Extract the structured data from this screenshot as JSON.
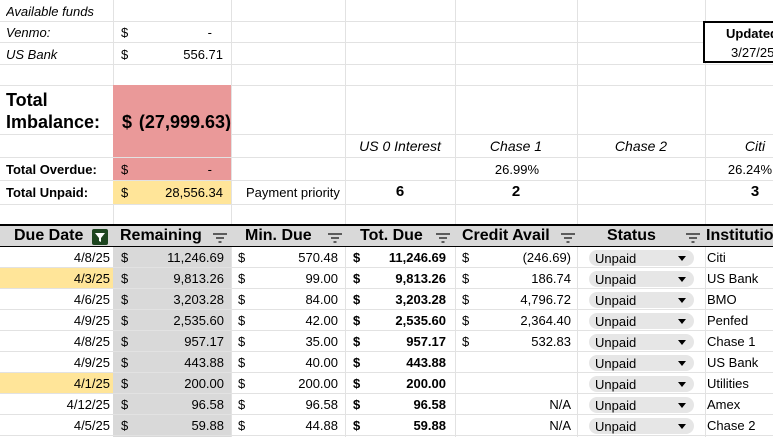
{
  "top": {
    "available_funds_label": "Available funds",
    "venmo_label": "Venmo:",
    "venmo_cur": "$",
    "venmo_value": "-",
    "usbank_label": "US Bank",
    "usbank_cur": "$",
    "usbank_value": "556.71",
    "updated_label": "Updated",
    "updated_date": "3/27/25"
  },
  "imbalance": {
    "label_line1": "Total",
    "label_line2": "Imbalance:",
    "cur": "$",
    "value": "(27,999.63)"
  },
  "summary": {
    "overdue_label": "Total Overdue:",
    "overdue_cur": "$",
    "overdue_value": "-",
    "unpaid_label": "Total Unpaid:",
    "unpaid_cur": "$",
    "unpaid_value": "28,556.34",
    "priority_label": "Payment priority"
  },
  "cards": [
    {
      "name": "US 0 Interest",
      "rate": "",
      "priority": "6"
    },
    {
      "name": "Chase 1",
      "rate": "26.99%",
      "priority": "2"
    },
    {
      "name": "Chase 2",
      "rate": "",
      "priority": ""
    },
    {
      "name": "Citi",
      "rate": "26.24%",
      "priority": "3"
    }
  ],
  "table": {
    "headers": [
      "Due Date",
      "Remaining",
      "Min. Due",
      "Tot. Due",
      "Credit Avail",
      "Status",
      "Institution"
    ],
    "rows": [
      {
        "due": "4/8/25",
        "rem": "11,246.69",
        "min": "570.48",
        "tot": "11,246.69",
        "credit": "(246.69)",
        "credit_cur": "$",
        "status": "Unpaid",
        "inst": "Citi",
        "hl": false
      },
      {
        "due": "4/3/25",
        "rem": "9,813.26",
        "min": "99.00",
        "tot": "9,813.26",
        "credit": "186.74",
        "credit_cur": "$",
        "status": "Unpaid",
        "inst": "US Bank",
        "hl": true
      },
      {
        "due": "4/6/25",
        "rem": "3,203.28",
        "min": "84.00",
        "tot": "3,203.28",
        "credit": "4,796.72",
        "credit_cur": "$",
        "status": "Unpaid",
        "inst": "BMO",
        "hl": false
      },
      {
        "due": "4/9/25",
        "rem": "2,535.60",
        "min": "42.00",
        "tot": "2,535.60",
        "credit": "2,364.40",
        "credit_cur": "$",
        "status": "Unpaid",
        "inst": "Penfed",
        "hl": false
      },
      {
        "due": "4/8/25",
        "rem": "957.17",
        "min": "35.00",
        "tot": "957.17",
        "credit": "532.83",
        "credit_cur": "$",
        "status": "Unpaid",
        "inst": "Chase 1",
        "hl": false
      },
      {
        "due": "4/9/25",
        "rem": "443.88",
        "min": "40.00",
        "tot": "443.88",
        "credit": "",
        "credit_cur": "",
        "status": "Unpaid",
        "inst": "US Bank",
        "hl": false
      },
      {
        "due": "4/1/25",
        "rem": "200.00",
        "min": "200.00",
        "tot": "200.00",
        "credit": "",
        "credit_cur": "",
        "status": "Unpaid",
        "inst": "Utilities",
        "hl": true
      },
      {
        "due": "4/12/25",
        "rem": "96.58",
        "min": "96.58",
        "tot": "96.58",
        "credit": "N/A",
        "credit_cur": "",
        "status": "Unpaid",
        "inst": "Amex",
        "hl": false
      },
      {
        "due": "4/5/25",
        "rem": "59.88",
        "min": "44.88",
        "tot": "59.88",
        "credit": "N/A",
        "credit_cur": "",
        "status": "Unpaid",
        "inst": "Chase 2",
        "hl": false
      }
    ],
    "currency": "$"
  },
  "colors": {
    "imbalance_bg": "#ea9999",
    "unpaid_bg": "#ffe599",
    "header_bg": "#d9d9d9",
    "remaining_col_bg": "#d9d9d9",
    "due_highlight": "#ffe599",
    "filter_active": "#1e4620"
  }
}
